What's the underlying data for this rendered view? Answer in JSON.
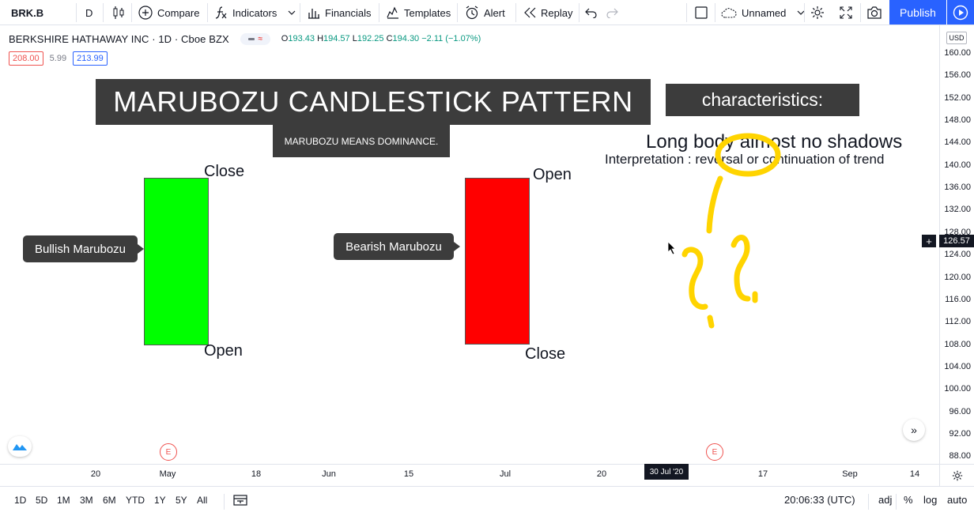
{
  "toolbar": {
    "symbol": "BRK.B",
    "interval": "D",
    "compare": "Compare",
    "indicators": "Indicators",
    "financials": "Financials",
    "templates": "Templates",
    "alert": "Alert",
    "replay": "Replay",
    "layout_name": "Unnamed",
    "publish": "Publish"
  },
  "legend": {
    "title": "BERKSHIRE HATHAWAY INC · 1D · Cboe BZX",
    "open_key": "O",
    "open": "193.43",
    "high_key": "H",
    "high": "194.57",
    "low_key": "L",
    "low": "192.25",
    "close_key": "C",
    "close": "194.30 −2.11 (−1.07%)",
    "bid": "208.00",
    "spread": "5.99",
    "ask": "213.99"
  },
  "annotations": {
    "title": "MARUBOZU CANDLESTICK PATTERN",
    "subtitle": "MARUBOZU MEANS DOMINANCE.",
    "characteristics": "characteristics:",
    "long_body": "Long body almost no shadows",
    "interpretation": "Interpretation : reversal or continuation of trend",
    "bullish_close": "Close",
    "bullish_open": "Open",
    "bearish_open": "Open",
    "bearish_close": "Close",
    "bullish_callout": "Bullish Marubozu",
    "bearish_callout": "Bearish Marubozu",
    "bullish_color": "#00ff00",
    "bearish_color": "#ff0000",
    "highlight_color": "#ffd400"
  },
  "price_axis": {
    "currency": "USD",
    "ticks": [
      "160.00",
      "156.00",
      "152.00",
      "148.00",
      "144.00",
      "140.00",
      "136.00",
      "132.00",
      "128.00",
      "124.00",
      "120.00",
      "116.00",
      "112.00",
      "108.00",
      "104.00",
      "100.00",
      "96.00",
      "92.00",
      "88.00"
    ],
    "current_price": "126.57"
  },
  "time_axis": {
    "ticks": [
      "20",
      "May",
      "18",
      "Jun",
      "15",
      "Jul",
      "20",
      "17",
      "Sep",
      "14"
    ],
    "crosshair_date": "30 Jul '20",
    "earnings_marker": "E"
  },
  "bottom_bar": {
    "ranges": [
      "1D",
      "5D",
      "1M",
      "3M",
      "6M",
      "YTD",
      "1Y",
      "5Y",
      "All"
    ],
    "clock": "20:06:33 (UTC)",
    "adj": "adj",
    "percent": "%",
    "log": "log",
    "auto": "auto"
  }
}
